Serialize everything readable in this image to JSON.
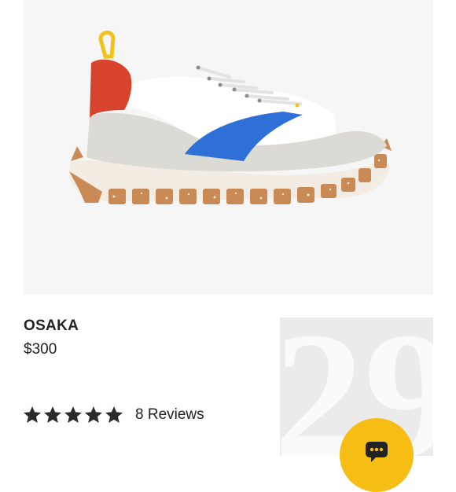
{
  "product": {
    "name": "OSAKA",
    "price": "$300"
  },
  "rating": {
    "stars": 5,
    "max_stars": 5,
    "reviews_label": "8 Reviews"
  },
  "thumbnail": {
    "digits": "29"
  },
  "colors": {
    "text": "#222222",
    "star": "#2b2b2b",
    "chat_button": "#f6bd14",
    "image_bg": "#f6f6f6",
    "sole_brown": "#c98a55",
    "stripe_blue": "#2f6fd8",
    "heel_red": "#d8432e",
    "pull_tab_yellow": "#f2c21b"
  },
  "icons": {
    "stars": "star-icon",
    "chat": "chat-icon"
  }
}
